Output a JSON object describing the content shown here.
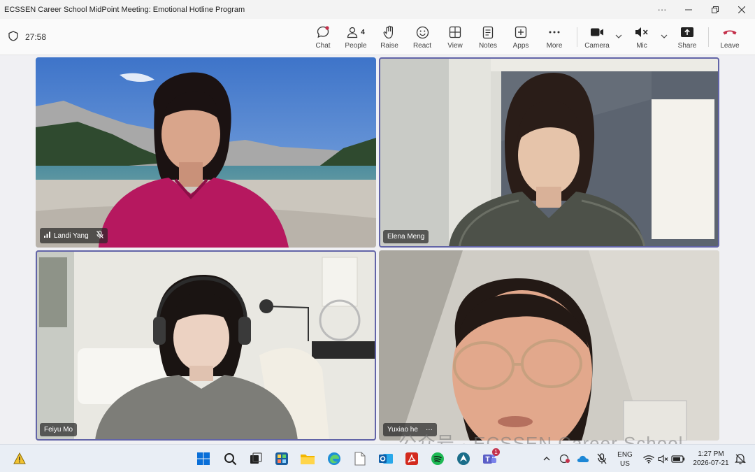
{
  "window": {
    "title": "ECSSEN Career School MidPoint Meeting: Emotional Hotline Program"
  },
  "toolbar": {
    "timer": "27:58",
    "people_count": "4",
    "items": [
      {
        "label": "Chat",
        "icon": "chat-icon"
      },
      {
        "label": "People",
        "icon": "people-icon"
      },
      {
        "label": "Raise",
        "icon": "hand-icon"
      },
      {
        "label": "React",
        "icon": "smiley-icon"
      },
      {
        "label": "View",
        "icon": "grid-icon"
      },
      {
        "label": "Notes",
        "icon": "notes-icon"
      },
      {
        "label": "Apps",
        "icon": "plus-icon"
      },
      {
        "label": "More",
        "icon": "more-icon"
      },
      {
        "label": "Camera",
        "icon": "camera-icon"
      },
      {
        "label": "Mic",
        "icon": "mic-muted-icon"
      },
      {
        "label": "Share",
        "icon": "share-icon"
      },
      {
        "label": "Leave",
        "icon": "phone-hangup-icon"
      }
    ],
    "leave_color": "#c4314b"
  },
  "participants": [
    {
      "name": "Landi Yang",
      "muted": true
    },
    {
      "name": "Elena Meng"
    },
    {
      "name": "Feiyu Mo"
    },
    {
      "name": "Yuxiao he",
      "more": "···"
    }
  ],
  "accent": "#6264a7",
  "watermark": "公众号 · ECSSEN Career School",
  "taskbar": {
    "language": "ENG",
    "region": "US",
    "time": "1:27 PM",
    "date": "2026-07-21",
    "teams_badge": "1"
  }
}
